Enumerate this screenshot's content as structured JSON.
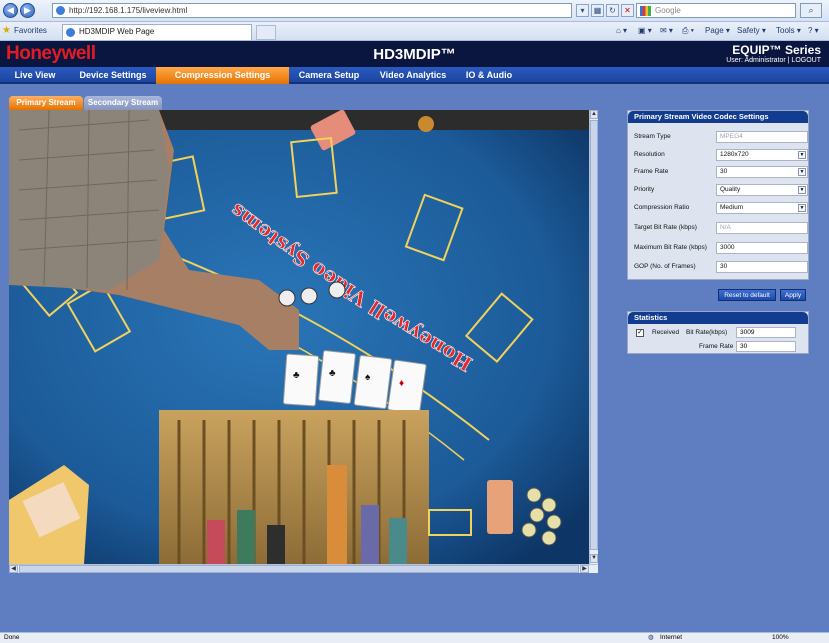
{
  "browser": {
    "url": "http://192.168.1.175/liveview.html",
    "search_placeholder": "Google",
    "favorites_label": "Favorites",
    "tab_title": "HD3MDIP Web Page",
    "commands": [
      "Page ▾",
      "Safety ▾",
      "Tools ▾"
    ],
    "status_left": "Done",
    "zone": "Internet",
    "zoom": "100%"
  },
  "app": {
    "brand": "Honeywell",
    "product": "HD3MDIP™",
    "series": "EQUIP™ Series",
    "user_line": "User: Administrator | LOGOUT"
  },
  "nav": {
    "items": [
      "Live View",
      "Device Settings",
      "Compression Settings",
      "Camera Setup",
      "Video Analytics",
      "IO & Audio"
    ],
    "active_index": 2
  },
  "streams": {
    "primary": "Primary Stream",
    "secondary": "Secondary Stream"
  },
  "codec": {
    "title": "Primary Stream Video Codec Settings",
    "fields": [
      {
        "label": "Stream Type",
        "value": "MPEG4",
        "type": "text-disabled"
      },
      {
        "label": "Resolution",
        "value": "1280x720",
        "type": "select"
      },
      {
        "label": "Frame Rate",
        "value": "30",
        "type": "select"
      },
      {
        "label": "Priority",
        "value": "Quality",
        "type": "select"
      },
      {
        "label": "Compression Ratio",
        "value": "Medium",
        "type": "select"
      },
      {
        "label": "Target Bit Rate (kbps)",
        "value": "N/A",
        "type": "text-disabled"
      },
      {
        "label": "Maximum Bit Rate (kbps)",
        "value": "3000",
        "type": "text"
      },
      {
        "label": "GOP (No. of Frames)",
        "value": "30",
        "type": "text"
      }
    ],
    "reset_label": "Reset to default",
    "apply_label": "Apply"
  },
  "stats": {
    "title": "Statistics",
    "received_label": "Received",
    "bitrate_label": "Bit Rate(kbps)",
    "bitrate_value": "3009",
    "framerate_label": "Frame Rate",
    "framerate_value": "30"
  },
  "video": {
    "table_text": "Honeywell Video Systems"
  },
  "colors": {
    "accent_orange": "#e57200",
    "nav_blue": "#1d45a0",
    "brand_red": "#e31b23",
    "header_navy": "#0a1640"
  }
}
